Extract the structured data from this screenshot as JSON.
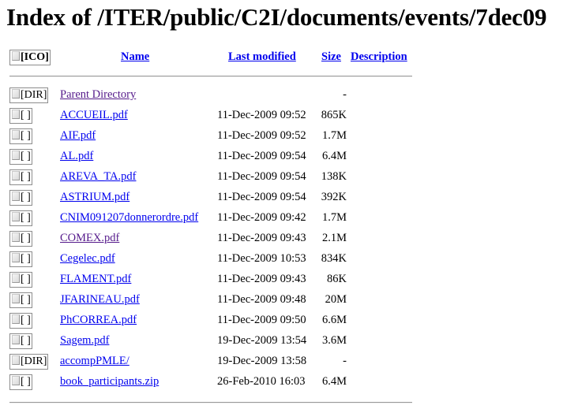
{
  "title": "Index of /ITER/public/C2I/documents/events/7dec09",
  "columns": {
    "icon": "[ICO]",
    "name": "Name",
    "last_modified": "Last modified",
    "size": "Size",
    "description": "Description"
  },
  "entries": [
    {
      "icon": "[DIR]",
      "icon_name": "folder-icon",
      "name": "Parent Directory",
      "date": "",
      "size": "-",
      "visited": true
    },
    {
      "icon": "[ ]",
      "icon_name": "file-icon",
      "name": "ACCUEIL.pdf",
      "date": "11-Dec-2009 09:52",
      "size": "865K",
      "visited": false
    },
    {
      "icon": "[ ]",
      "icon_name": "file-icon",
      "name": "AIF.pdf",
      "date": "11-Dec-2009 09:52",
      "size": "1.7M",
      "visited": false
    },
    {
      "icon": "[ ]",
      "icon_name": "file-icon",
      "name": "AL.pdf",
      "date": "11-Dec-2009 09:54",
      "size": "6.4M",
      "visited": false
    },
    {
      "icon": "[ ]",
      "icon_name": "file-icon",
      "name": "AREVA_TA.pdf",
      "date": "11-Dec-2009 09:54",
      "size": "138K",
      "visited": false
    },
    {
      "icon": "[ ]",
      "icon_name": "file-icon",
      "name": "ASTRIUM.pdf",
      "date": "11-Dec-2009 09:54",
      "size": "392K",
      "visited": false
    },
    {
      "icon": "[ ]",
      "icon_name": "file-icon",
      "name": "CNIM091207donnerordre.pdf",
      "date": "11-Dec-2009 09:42",
      "size": "1.7M",
      "visited": false
    },
    {
      "icon": "[ ]",
      "icon_name": "file-icon",
      "name": "COMEX.pdf",
      "date": "11-Dec-2009 09:43",
      "size": "2.1M",
      "visited": true
    },
    {
      "icon": "[ ]",
      "icon_name": "file-icon",
      "name": "Cegelec.pdf",
      "date": "11-Dec-2009 10:53",
      "size": "834K",
      "visited": false
    },
    {
      "icon": "[ ]",
      "icon_name": "file-icon",
      "name": "FLAMENT.pdf",
      "date": "11-Dec-2009 09:43",
      "size": "86K",
      "visited": false
    },
    {
      "icon": "[ ]",
      "icon_name": "file-icon",
      "name": "JFARINEAU.pdf",
      "date": "11-Dec-2009 09:48",
      "size": "20M",
      "visited": false
    },
    {
      "icon": "[ ]",
      "icon_name": "file-icon",
      "name": "PhCORREA.pdf",
      "date": "11-Dec-2009 09:50",
      "size": "6.6M",
      "visited": false
    },
    {
      "icon": "[ ]",
      "icon_name": "file-icon",
      "name": "Sagem.pdf",
      "date": "19-Dec-2009 13:54",
      "size": "3.6M",
      "visited": false
    },
    {
      "icon": "[DIR]",
      "icon_name": "folder-icon",
      "name": "accompPMLE/",
      "date": "19-Dec-2009 13:58",
      "size": "-",
      "visited": false
    },
    {
      "icon": "[ ]",
      "icon_name": "file-icon",
      "name": "book_participants.zip",
      "date": "26-Feb-2010 16:03",
      "size": "6.4M",
      "visited": false
    }
  ]
}
